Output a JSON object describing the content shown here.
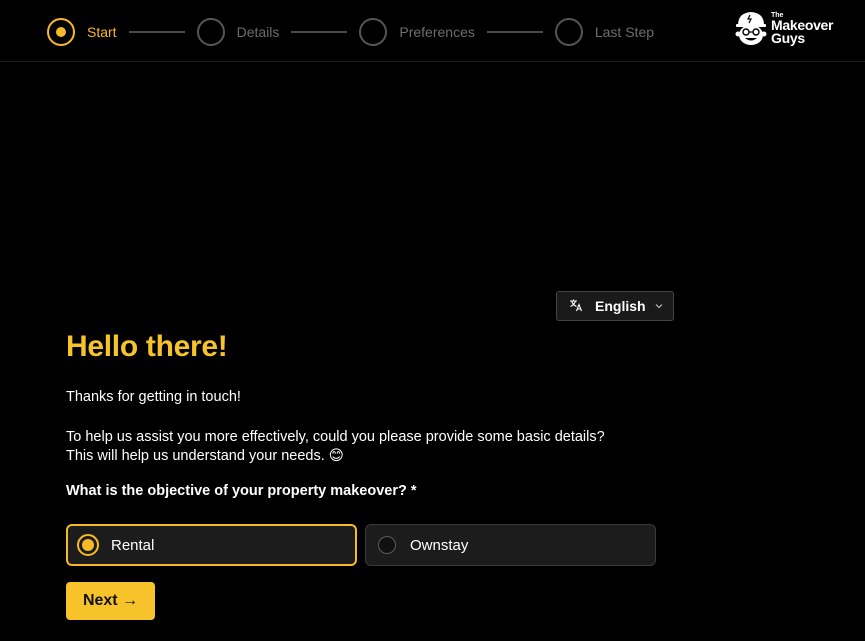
{
  "stepper": {
    "steps": [
      {
        "label": "Start",
        "active": true
      },
      {
        "label": "Details",
        "active": false
      },
      {
        "label": "Preferences",
        "active": false
      },
      {
        "label": "Last Step",
        "active": false
      }
    ]
  },
  "logo": {
    "the": "The",
    "line1": "Makeover",
    "line2": "Guys"
  },
  "language": {
    "selected": "English",
    "icon": "translate-icon",
    "chevron": "chevron-down-icon"
  },
  "form": {
    "title": "Hello there!",
    "intro": "Thanks for getting in touch!",
    "description": "To help us assist you more effectively, could you please provide some basic details? This will help us understand your needs. 😊",
    "question": "What is the objective of your property makeover? *",
    "options": [
      {
        "label": "Rental",
        "selected": true
      },
      {
        "label": "Ownstay",
        "selected": false
      }
    ],
    "next_label": "Next →"
  },
  "colors": {
    "accent": "#f7b928",
    "title": "#f7c32b",
    "background": "#000000"
  }
}
